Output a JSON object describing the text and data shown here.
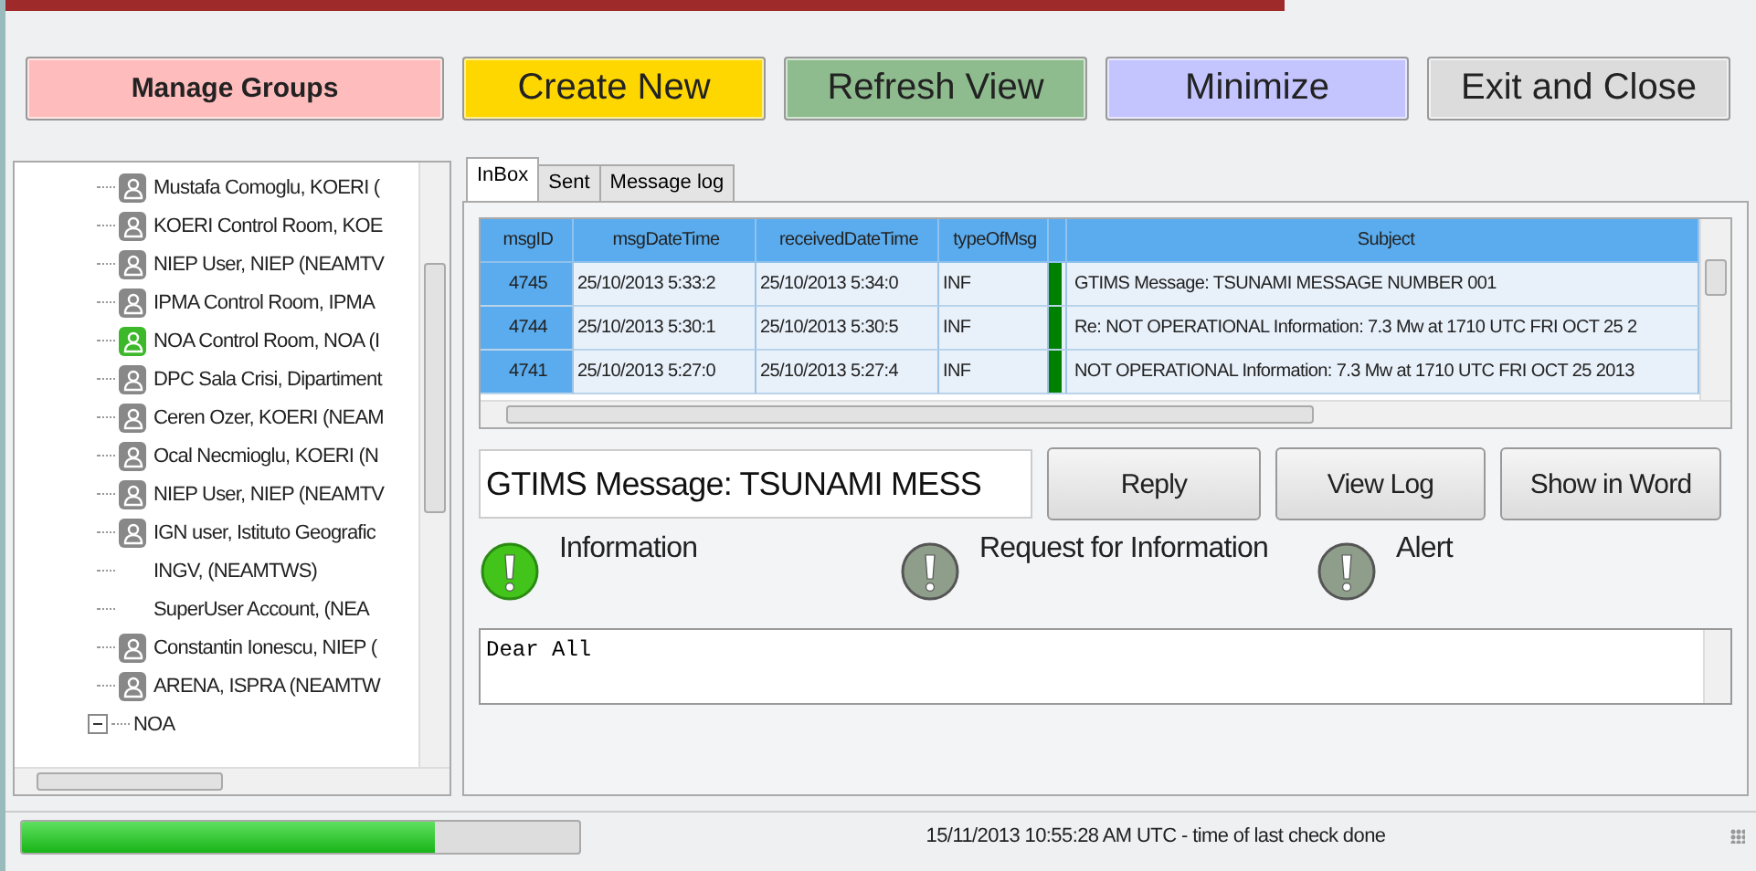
{
  "toolbar": [
    {
      "label": "Manage Groups",
      "color": "#ffbcbc"
    },
    {
      "label": "Create New",
      "color": "#ffd700"
    },
    {
      "label": "Refresh View",
      "color": "#8fbc8f"
    },
    {
      "label": "Minimize",
      "color": "#c4c4ff"
    },
    {
      "label": "Exit and Close",
      "color": "#dcdcdc"
    }
  ],
  "tree": [
    {
      "children": [
        {
          "label": "Mustafa Comoglu, KOERI (",
          "kind": "user",
          "online": false
        },
        {
          "label": "KOERI Control Room, KOE",
          "kind": "user",
          "online": false
        },
        {
          "label": "NIEP User, NIEP (NEAMTV",
          "kind": "user",
          "online": false
        },
        {
          "label": "IPMA Control Room, IPMA",
          "kind": "user",
          "online": false
        },
        {
          "label": "NOA Control Room, NOA (I",
          "kind": "user",
          "online": true
        },
        {
          "label": "DPC Sala Crisi, Dipartiment",
          "kind": "user",
          "online": false
        },
        {
          "label": "Ceren Ozer, KOERI (NEAM",
          "kind": "user",
          "online": false
        },
        {
          "label": "Ocal Necmioglu, KOERI (N",
          "kind": "user",
          "online": false
        },
        {
          "label": "NIEP User, NIEP (NEAMTV",
          "kind": "user",
          "online": false
        },
        {
          "label": "IGN user, Istituto Geografic",
          "kind": "user",
          "online": false
        },
        {
          "label": "INGV,  (NEAMTWS)",
          "kind": "plain"
        },
        {
          "label": "SuperUser Account,  (NEA",
          "kind": "plain"
        },
        {
          "label": "Constantin Ionescu, NIEP (",
          "kind": "user",
          "online": false
        },
        {
          "label": "ARENA, ISPRA (NEAMTW",
          "kind": "user",
          "online": false
        }
      ]
    },
    {
      "label": "NOA",
      "expanded": true
    }
  ],
  "tabs": [
    {
      "label": "InBox",
      "selected": true
    },
    {
      "label": "Sent",
      "selected": false
    },
    {
      "label": "Message log",
      "selected": false
    }
  ],
  "table": {
    "columns": [
      "msgID",
      "msgDateTime",
      "receivedDateTime",
      "typeOfMsg",
      "Subject"
    ],
    "rows": [
      {
        "cells": [
          "4745",
          "25/10/2013 5:33:2",
          "25/10/2013 5:34:0",
          "INF",
          "GTIMS Message:   TSUNAMI MESSAGE NUMBER 001"
        ],
        "color": "#008000"
      },
      {
        "cells": [
          "4744",
          "25/10/2013 5:30:1",
          "25/10/2013 5:30:5",
          "INF",
          "Re: NOT OPERATIONAL Information: 7.3 Mw at 1710 UTC FRI OCT 25 2"
        ],
        "color": "#008000"
      },
      {
        "cells": [
          "4741",
          "25/10/2013 5:27:0",
          "25/10/2013 5:27:4",
          "INF",
          "NOT OPERATIONAL Information: 7.3 Mw at 1710 UTC FRI OCT 25 2013"
        ],
        "color": "#008000"
      }
    ]
  },
  "subject_field": {
    "value": "GTIMS Message:   TSUNAMI MESS"
  },
  "actions": [
    "Reply",
    "View Log",
    "Show in Word"
  ],
  "message_types": [
    {
      "label": "Information",
      "selected": true
    },
    {
      "label": "Request for Information",
      "selected": false
    },
    {
      "label": "Alert",
      "selected": false
    }
  ],
  "body": {
    "value": "Dear All"
  },
  "status_bar": {
    "progress": {
      "level": 0.74
    },
    "text": "15/11/2013 10:55:28 AM UTC - time of last check done"
  }
}
